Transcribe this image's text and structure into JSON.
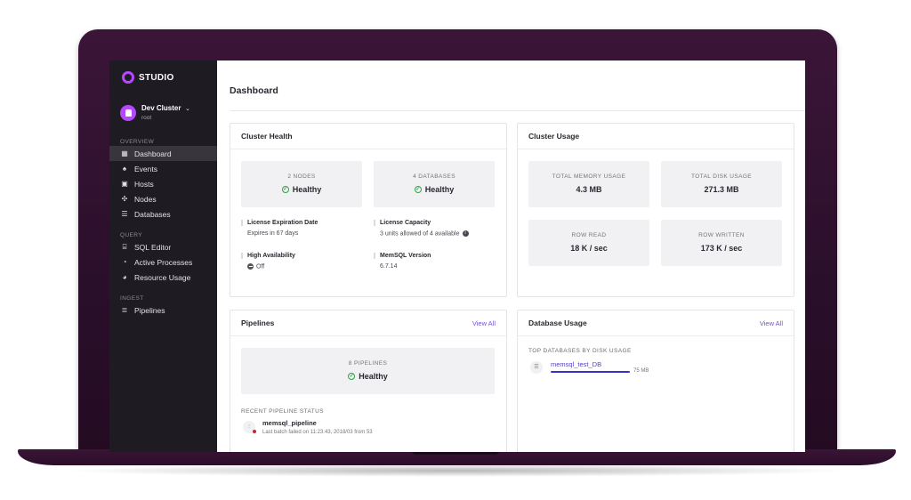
{
  "app": {
    "logo_text": "STUDIO"
  },
  "cluster": {
    "name": "Dev Cluster",
    "chevron": "⌄",
    "user": "root"
  },
  "sidebar": {
    "sections": [
      {
        "label": "OVERVIEW",
        "items": [
          {
            "label": "Dashboard",
            "icon": "dashboard-icon",
            "active": true
          },
          {
            "label": "Events",
            "icon": "bell-icon"
          },
          {
            "label": "Hosts",
            "icon": "host-icon"
          },
          {
            "label": "Nodes",
            "icon": "nodes-icon"
          },
          {
            "label": "Databases",
            "icon": "database-icon"
          }
        ]
      },
      {
        "label": "QUERY",
        "items": [
          {
            "label": "SQL Editor",
            "icon": "sql-editor-icon"
          },
          {
            "label": "Active Processes",
            "icon": "processes-icon"
          },
          {
            "label": "Resource Usage",
            "icon": "resource-icon"
          }
        ]
      },
      {
        "label": "INGEST",
        "items": [
          {
            "label": "Pipelines",
            "icon": "pipelines-icon"
          }
        ]
      }
    ]
  },
  "page": {
    "title": "Dashboard"
  },
  "cluster_health": {
    "title": "Cluster Health",
    "tiles": [
      {
        "label": "2 NODES",
        "status": "Healthy"
      },
      {
        "label": "4 DATABASES",
        "status": "Healthy"
      }
    ],
    "license_expiration": {
      "key": "License Expiration Date",
      "value": "Expires in 67 days"
    },
    "license_capacity": {
      "key": "License Capacity",
      "value": "3 units allowed of 4 available"
    },
    "high_availability": {
      "key": "High Availability",
      "value": "Off"
    },
    "version": {
      "key": "MemSQL Version",
      "value": "6.7.14"
    }
  },
  "cluster_usage": {
    "title": "Cluster Usage",
    "tiles": [
      {
        "label": "TOTAL MEMORY USAGE",
        "value": "4.3 MB"
      },
      {
        "label": "TOTAL DISK USAGE",
        "value": "271.3 MB"
      },
      {
        "label": "ROW READ",
        "value": "18 K / sec"
      },
      {
        "label": "ROW WRITTEN",
        "value": "173 K / sec"
      }
    ]
  },
  "pipelines": {
    "title": "Pipelines",
    "view_all": "View All",
    "tile": {
      "label": "8 PIPELINES",
      "status": "Healthy"
    },
    "recent_label": "RECENT PIPELINE STATUS",
    "recent": {
      "name": "memsql_pipeline",
      "detail": "Last batch failed on 11:23:43, 2018/03 from 53"
    }
  },
  "database_usage": {
    "title": "Database Usage",
    "view_all": "View All",
    "top_label": "TOP DATABASES BY DISK USAGE",
    "db": {
      "name": "memsql_test_DB",
      "size": "75 MB",
      "fraction": 1.0
    }
  },
  "colors": {
    "accent": "#b547ff",
    "link": "#7a4fd6",
    "healthy": "#31a24c",
    "bar": "#3b2fc7"
  }
}
